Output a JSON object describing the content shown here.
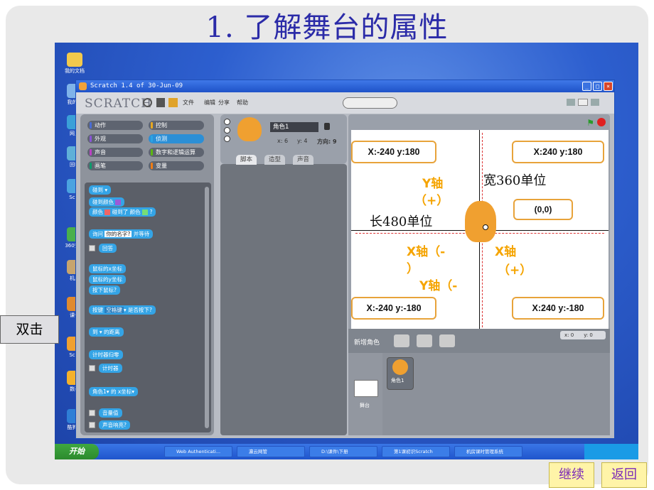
{
  "slide": {
    "title": "1. 了解舞台的属性",
    "side_label": "双击",
    "continue_label": "继续",
    "back_label": "返回"
  },
  "desktop": {
    "icons": [
      "我的文档",
      "我的电",
      "网上",
      "回收",
      "Scra",
      "Scre",
      "机房",
      "课件",
      "360安全",
      "数码",
      "酷狗音"
    ]
  },
  "window": {
    "title": "Scratch 1.4 of 30-Jun-09",
    "logo": "SCRATCH",
    "menus": [
      "文件",
      "编辑",
      "分享",
      "帮助"
    ]
  },
  "categories": [
    "动作",
    "控制",
    "外观",
    "侦测",
    "声音",
    "数字和逻辑运算",
    "画笔",
    "变量"
  ],
  "category_colors": [
    "#4a6cd4",
    "#e6a822",
    "#8a55d7",
    "#2ca5e2",
    "#bb42c3",
    "#5cb712",
    "#0e9a6c",
    "#ee7d16"
  ],
  "blocks": {
    "touching": "碰到",
    "touching_color": "碰到颜色",
    "color_touching_a": "颜色",
    "color_touching_b": "碰到了 颜色",
    "color_touching_c": "?",
    "ask": "询问",
    "ask_default": "你的名字?",
    "ask_wait": "并等待",
    "answer": "回答",
    "mouse_x": "鼠标的x坐标",
    "mouse_y": "鼠标的y坐标",
    "mouse_down": "按下鼠标?",
    "key_pressed_a": "按键",
    "key_pressed_key": "空格键",
    "key_pressed_b": "是否按下?",
    "distance_a": "到",
    "distance_b": "的距离",
    "reset_timer": "计时器归零",
    "timer": "计时器",
    "attr_a": "角色1",
    "attr_b": "的",
    "attr_c": "x坐标",
    "loudness": "音量值",
    "loud": "声音响亮?"
  },
  "sprite_info": {
    "name": "角色1",
    "x": "x: 6",
    "y": "y: 4",
    "direction": "方向: 9"
  },
  "tabs": [
    "脚本",
    "造型",
    "声音"
  ],
  "stage": {
    "top_left": "X:-240 y:180",
    "top_right": "X:240 y:180",
    "bottom_left": "X:-240 y:-180",
    "bottom_right": "X:240 y:-180",
    "origin": "(0,0)",
    "width_label": "宽360单位",
    "length_label": "长480单位",
    "y_pos_a": "Y轴",
    "y_pos_b": "（+）",
    "x_neg_a": "X轴（-",
    "x_neg_b": "）",
    "x_pos_a": "X轴",
    "x_pos_b": "（+）",
    "y_neg": "Y轴（-",
    "mouse_x": "x: 0",
    "mouse_y": "y: 0"
  },
  "sprites_pane": {
    "new_sprite": "新增角色",
    "stage_label": "舞台",
    "sprite_label": "角色1"
  },
  "taskbar": {
    "start": "开始",
    "tasks": [
      "Web Authenticati...",
      "瀛云网管",
      "D:\\课件\\下册",
      "第1课初识Scratch",
      "机房课时管理系统"
    ]
  }
}
